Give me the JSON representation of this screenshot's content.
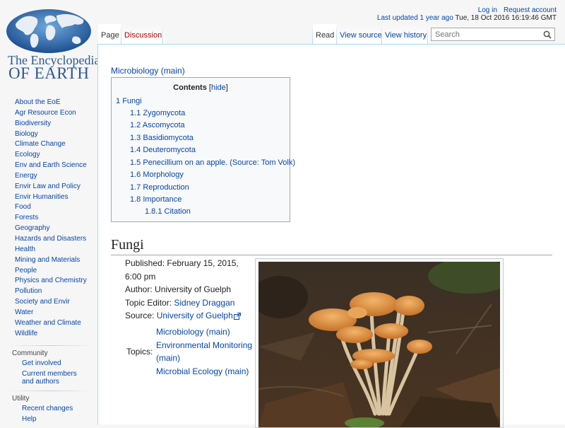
{
  "site": {
    "logo_line1": "The Encyclopedia",
    "logo_line2": "OF EARTH"
  },
  "personal": {
    "login": "Log in",
    "request_account": "Request account",
    "last_updated_link": "Last updated 1 year ago",
    "last_updated_date": " Tue, 18 Oct 2016 16:19:46 GMT"
  },
  "tabs": {
    "page": "Page",
    "discussion": "Discussion",
    "read": "Read",
    "view_source": "View source",
    "view_history": "View history"
  },
  "search": {
    "placeholder": "Search"
  },
  "sidebar": {
    "nav": [
      "About the EoE",
      "Agr Resource Econ",
      "Biodiversity",
      "Biology",
      "Climate Change",
      "Ecology",
      "Env and Earth Science",
      "Energy",
      "Envir Law and Policy",
      "Envir Humanities",
      "Food",
      "Forests",
      "Geography",
      "Hazards and Disasters",
      "Health",
      "Mining and Materials",
      "People",
      "Physics and Chemistry",
      "Pollution",
      "Society and Envir",
      "Water",
      "Weather and Climate",
      "Wildlife"
    ],
    "community_heading": "Community",
    "community": [
      "Get involved",
      "Current members and authors"
    ],
    "utility_heading": "Utility",
    "utility": [
      "Recent changes",
      "Help"
    ]
  },
  "content": {
    "subtitle_link": "Microbiology (main)",
    "toc": {
      "title": "Contents",
      "hide_open": "[",
      "hide": "hide",
      "hide_close": "]",
      "items": [
        {
          "num": "1",
          "text": "Fungi"
        },
        {
          "num": "1.1",
          "text": "Zygomycota"
        },
        {
          "num": "1.2",
          "text": "Ascomycota"
        },
        {
          "num": "1.3",
          "text": "Basidiomycota"
        },
        {
          "num": "1.4",
          "text": "Deuteromycota"
        },
        {
          "num": "1.5",
          "text": "Penecillium on an apple. (Source: Tom Volk)"
        },
        {
          "num": "1.6",
          "text": "Morphology"
        },
        {
          "num": "1.7",
          "text": "Reproduction"
        },
        {
          "num": "1.8",
          "text": "Importance"
        },
        {
          "num": "1.8.1",
          "text": "Citation"
        }
      ]
    },
    "heading": "Fungi",
    "info": {
      "published": "Published: February 15, 2015, 6:00 pm",
      "author": "Author: University of Guelph",
      "topic_editor_label": "Topic Editor: ",
      "topic_editor": "Sidney Draggan",
      "source_label": "Source: ",
      "source": "University of Guelph",
      "topics_label": "Topics:",
      "topics": [
        "Microbiology (main)",
        "Environmental Monitoring (main)",
        "Microbial Ecology (main)"
      ]
    },
    "image": "mushrooms-photo"
  },
  "colors": {
    "link": "#0645ad",
    "logo_blue": "#2b5797",
    "border_blue": "#a7d7f9",
    "bg_gray": "#f6f6f6"
  }
}
